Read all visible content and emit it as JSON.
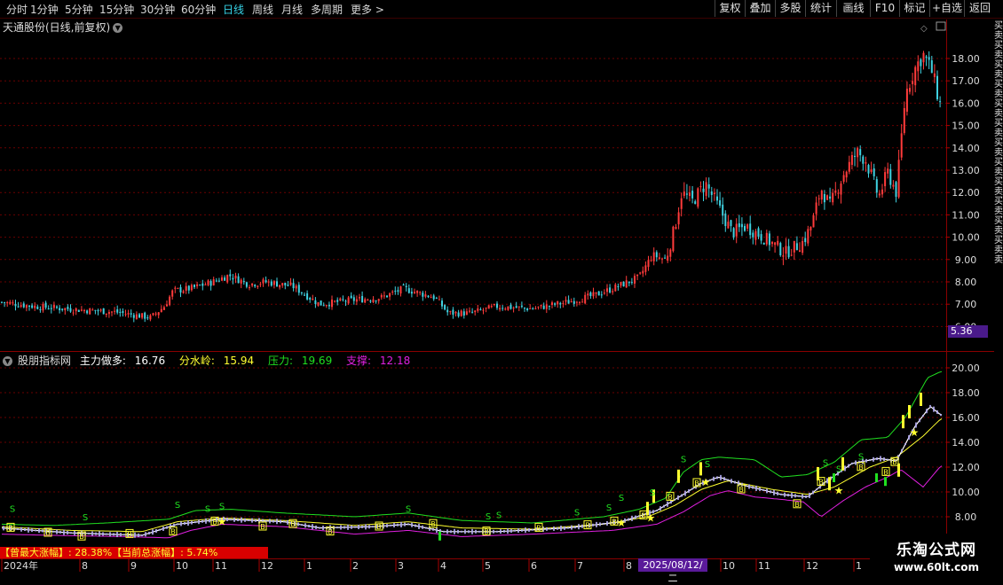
{
  "toolbar": {
    "periods": [
      "分时",
      "1分钟",
      "5分钟",
      "15分钟",
      "30分钟",
      "60分钟",
      "日线",
      "周线",
      "月线",
      "多周期",
      "更多 >"
    ],
    "active_period": "日线",
    "buttons": [
      "复权",
      "叠加",
      "多股",
      "统计",
      "画线",
      "F10",
      "标记",
      "+自选",
      "返回"
    ]
  },
  "upper": {
    "title": "天通股份(日线,前复权)",
    "price_axis": [
      "18.00",
      "17.00",
      "16.00",
      "15.00",
      "14.00",
      "13.00",
      "12.00",
      "11.00",
      "10.00",
      "9.00",
      "8.00",
      "7.00",
      "6.00"
    ],
    "current_price_tag": "5.36",
    "side_text": "买卖买卖买卖买卖买卖买卖买卖买卖买卖买卖买卖买卖卖"
  },
  "indicator": {
    "name": "股朋指标网",
    "main_label": "主力做多:",
    "main_value": "16.76",
    "water_label": "分水岭:",
    "water_value": "15.94",
    "pressure_label": "压力:",
    "pressure_value": "19.69",
    "support_label": "支撑:",
    "support_value": "12.18",
    "axis": [
      "20.00",
      "18.00",
      "16.00",
      "14.00",
      "12.00",
      "10.00",
      "8.00"
    ],
    "gain_text": "【曾最大涨幅】: 28.38%【当前总涨幅】: 5.74%"
  },
  "time_axis": {
    "labels": [
      "2024年",
      "8",
      "9",
      "10",
      "11",
      "12",
      "1",
      "2",
      "3",
      "4",
      "5",
      "6",
      "7",
      "8",
      "10",
      "11",
      "12",
      "1"
    ],
    "cursor_date": "2025/08/12/二"
  },
  "colors": {
    "up": "#ff3b3b",
    "down": "#3fd1e0",
    "main": "#ffffff",
    "water": "#ffff30",
    "pressure": "#20e020",
    "support": "#e020e0",
    "grid": "#6a0000",
    "active": "#36d2e6"
  },
  "watermark": {
    "title": "乐淘公式网",
    "url": "www.60lt.com"
  }
}
